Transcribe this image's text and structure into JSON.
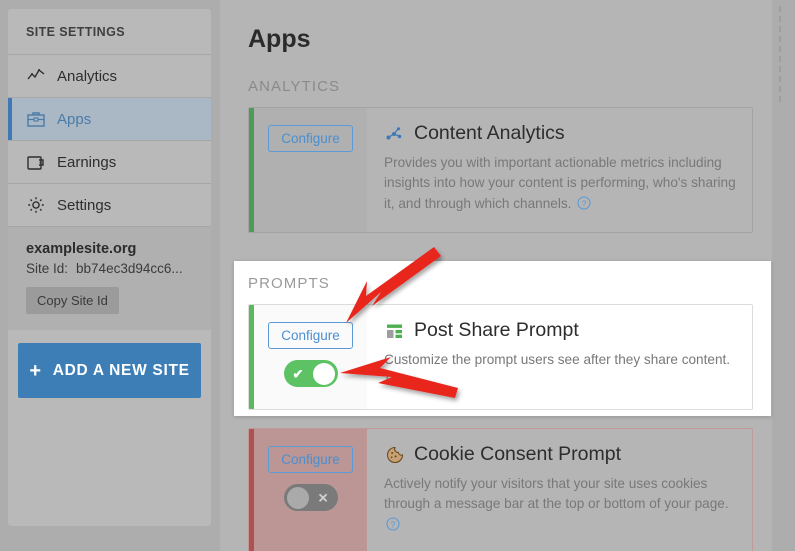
{
  "sidebar": {
    "header": "SITE SETTINGS",
    "items": [
      {
        "label": "Analytics",
        "icon": "analytics-line-icon",
        "active": false
      },
      {
        "label": "Apps",
        "icon": "toolbox-icon",
        "active": true
      },
      {
        "label": "Earnings",
        "icon": "wallet-icon",
        "active": false
      },
      {
        "label": "Settings",
        "icon": "gear-icon",
        "active": false
      }
    ],
    "site": {
      "name": "examplesite.org",
      "site_id_label": "Site Id:",
      "site_id_value": "bb74ec3d94cc6...",
      "copy_button": "Copy Site Id"
    },
    "add_site_button": {
      "plus": "+",
      "label": "ADD A NEW SITE"
    }
  },
  "main": {
    "title": "Apps",
    "sections": [
      {
        "label": "ANALYTICS",
        "apps": [
          {
            "configure_label": "Configure",
            "icon": "network-nodes-icon",
            "title": "Content Analytics",
            "description": "Provides you with important actionable metrics including insights into how your content is performing, who's sharing it, and through which channels.",
            "help_icon": "help-circle-icon",
            "toggle": null,
            "accent_color": "#4e9a57"
          }
        ]
      },
      {
        "label": "PROMPTS",
        "highlighted": true,
        "apps": [
          {
            "configure_label": "Configure",
            "icon": "post-share-icon",
            "title": "Post Share Prompt",
            "description": "Customize the prompt users see after they share content.",
            "help_icon": "help-circle-icon",
            "toggle": {
              "state": "on",
              "mark": "✔"
            },
            "accent_color": "#5cb85c"
          }
        ]
      },
      {
        "label": "",
        "apps": [
          {
            "configure_label": "Configure",
            "icon": "cookie-icon",
            "title": "Cookie Consent Prompt",
            "description": "Actively notify your visitors that your site uses cookies through a message bar at the top or bottom of your page.",
            "help_icon": "help-circle-icon",
            "toggle": {
              "state": "off",
              "mark": "✕"
            },
            "accent_color": "#b05050"
          }
        ]
      }
    ]
  },
  "annotations": {
    "arrow_color": "#e8251b",
    "arrows": [
      {
        "name": "arrow-to-configure-button"
      },
      {
        "name": "arrow-to-enable-toggle"
      }
    ]
  },
  "colors": {
    "accent_blue": "#3c7eb5",
    "green": "#5cb85c",
    "red": "#b05050",
    "background": "#adadad"
  }
}
